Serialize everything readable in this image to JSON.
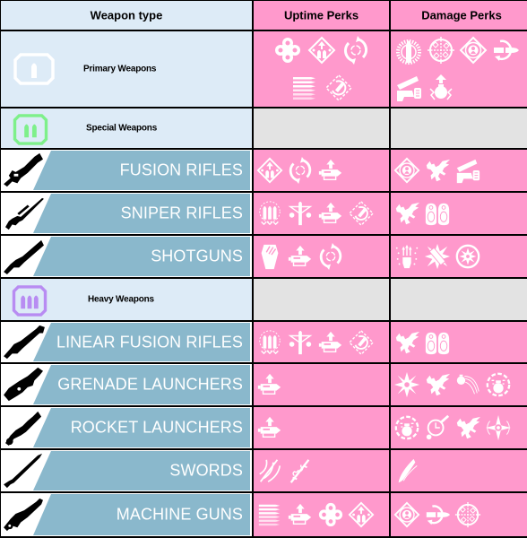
{
  "header": {
    "weapon_type": "Weapon type",
    "uptime_perks": "Uptime Perks",
    "damage_perks": "Damage Perks"
  },
  "colors": {
    "weapon_column_bg": "#ddebf7",
    "perk_bg": "#ff99cc",
    "empty_bg": "#e3e3e3",
    "banner": "#8ab8cc",
    "grid_line": "#000000",
    "primary_ammo": "#ffffff",
    "special_ammo": "#7ef08a",
    "heavy_ammo": "#b88cf2"
  },
  "rows": [
    {
      "kind": "category",
      "label": "Primary Weapons",
      "ammo_icon": "primary-ammo",
      "uptime": [
        "four-circles",
        "diamond-bullets-arrow",
        "circular-arrows",
        "ammo-bars",
        "diamond-circle-arrow"
      ],
      "damage": [
        "bullet-sunburst",
        "crosshair-diamonds",
        "diamond-target",
        "bullet-circle-arrow",
        "gun-hand",
        "grenade-arrow"
      ]
    },
    {
      "kind": "category",
      "label": "Special Weapons",
      "ammo_icon": "special-ammo",
      "uptime": [],
      "damage": []
    },
    {
      "kind": "weapon",
      "label": "FUSION RIFLES",
      "weapon_icon": "fusion-rifle",
      "uptime": [
        "diamond-bullets-arrow",
        "circular-arrows",
        "mag-arrow"
      ],
      "damage": [
        "diamond-target",
        "dragon",
        "gun-hand"
      ]
    },
    {
      "kind": "weapon",
      "label": "SNIPER RIFLES",
      "weapon_icon": "sniper-rifle",
      "uptime": [
        "bullets-crosshair",
        "bullet-tee",
        "mag-arrow",
        "diamond-circle-arrow"
      ],
      "damage": [
        "dragon",
        "target-silhouettes"
      ]
    },
    {
      "kind": "weapon",
      "label": "SHOTGUNS",
      "weapon_icon": "shotgun",
      "uptime": [
        "coffin-claw",
        "mag-arrow",
        "circular-arrows"
      ],
      "damage": [
        "fist-burst",
        "shell-explosion",
        "circle-burst"
      ]
    },
    {
      "kind": "category",
      "label": "Heavy Weapons",
      "ammo_icon": "heavy-ammo",
      "uptime": [],
      "damage": []
    },
    {
      "kind": "weapon",
      "label": "LINEAR FUSION RIFLES",
      "weapon_icon": "linear-fusion-rifle",
      "uptime": [
        "bullets-crosshair",
        "bullet-tee",
        "mag-arrow",
        "diamond-circle-arrow"
      ],
      "damage": [
        "dragon",
        "target-silhouettes"
      ]
    },
    {
      "kind": "weapon",
      "label": "GRENADE LAUNCHERS",
      "weapon_icon": "grenade-launcher",
      "uptime": [
        "mag-arrow"
      ],
      "damage": [
        "star-burst",
        "dragon",
        "comet",
        "circle-grenade"
      ]
    },
    {
      "kind": "weapon",
      "label": "ROCKET LAUNCHERS",
      "weapon_icon": "rocket-launcher",
      "uptime": [
        "mag-arrow"
      ],
      "damage": [
        "circle-grenade",
        "timer-bomb",
        "dragon",
        "four-point-star"
      ]
    },
    {
      "kind": "weapon",
      "label": "SWORDS",
      "weapon_icon": "sword",
      "uptime": [
        "slash-claws",
        "sword-vine"
      ],
      "damage": [
        "blade-wave"
      ]
    },
    {
      "kind": "weapon",
      "label": "MACHINE GUNS",
      "weapon_icon": "machine-gun",
      "uptime": [
        "ammo-bars",
        "mag-arrow",
        "four-circles",
        "diamond-bullets-arrow"
      ],
      "damage": [
        "diamond-target",
        "bullet-circle-arrow",
        "crosshair-diamonds"
      ]
    }
  ]
}
